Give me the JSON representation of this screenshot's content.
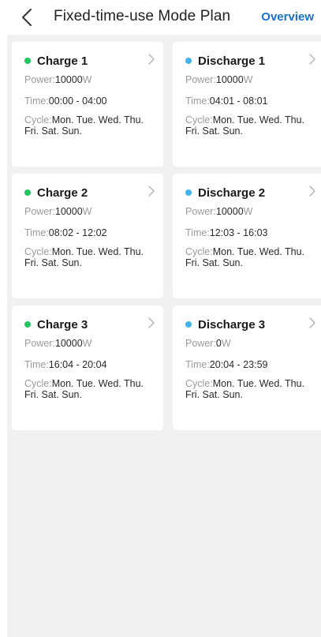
{
  "header": {
    "title": "Fixed-time-use Mode Plan",
    "overview_label": "Overview"
  },
  "labels": {
    "power": "Power:",
    "time": "Time:",
    "cycle": "Cycle:"
  },
  "colors": {
    "charge_dot": "#22c55e",
    "discharge_dot": "#3fb4ee",
    "accent": "#1a6fd1"
  },
  "cards": [
    {
      "title": "Charge 1",
      "type": "charge",
      "power": "10000",
      "power_unit": "W",
      "time": "00:00 - 04:00",
      "cycle": "Mon. Tue. Wed. Thu. Fri. Sat. Sun."
    },
    {
      "title": "Discharge 1",
      "type": "discharge",
      "power": "10000",
      "power_unit": "W",
      "time": "04:01 - 08:01",
      "cycle": "Mon. Tue. Wed. Thu. Fri. Sat. Sun."
    },
    {
      "title": "Charge 2",
      "type": "charge",
      "power": "10000",
      "power_unit": "W",
      "time": "08:02 - 12:02",
      "cycle": "Mon. Tue. Wed. Thu. Fri. Sat. Sun."
    },
    {
      "title": "Discharge 2",
      "type": "discharge",
      "power": "10000",
      "power_unit": "W",
      "time": "12:03 - 16:03",
      "cycle": "Mon. Tue. Wed. Thu. Fri. Sat. Sun."
    },
    {
      "title": "Charge 3",
      "type": "charge",
      "power": "10000",
      "power_unit": "W",
      "time": "16:04 - 20:04",
      "cycle": "Mon. Tue. Wed. Thu. Fri. Sat. Sun."
    },
    {
      "title": "Discharge 3",
      "type": "discharge",
      "power": "0",
      "power_unit": "W",
      "time": "20:04 - 23:59",
      "cycle": "Mon. Tue. Wed. Thu. Fri. Sat. Sun."
    }
  ]
}
